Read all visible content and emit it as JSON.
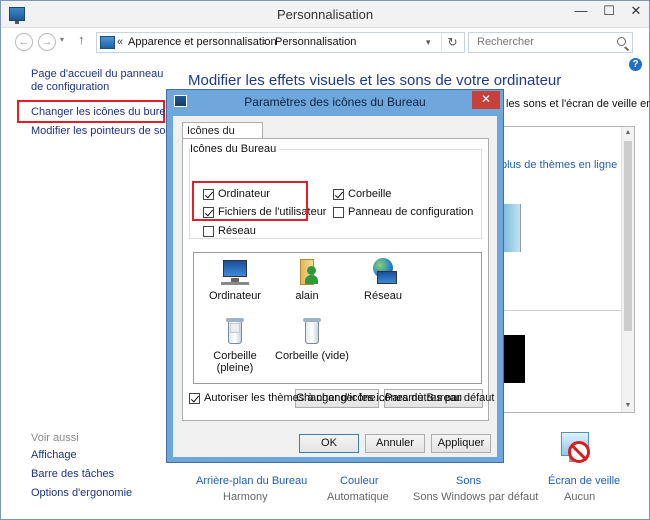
{
  "window": {
    "title": "Personnalisation",
    "minimize": "—",
    "maximize": "☐",
    "close": "✕"
  },
  "nav": {
    "back": "←",
    "forward": "→",
    "dropdown": "▾",
    "up": "↑"
  },
  "address": {
    "sep0": "«",
    "crumb1": "Apparence et personnalisation",
    "sep1": "›",
    "crumb2": "Personnalisation",
    "dropdown": "▾",
    "refresh": "↻"
  },
  "search": {
    "placeholder": "Rechercher"
  },
  "help": "?",
  "left_pane": {
    "home_link": "Page d'accueil du panneau de configuration",
    "change_icons": "Changer les icônes du bureau",
    "change_pointers": "Modifier les pointeurs de souris",
    "see_also": "Voir aussi",
    "see_also_links": [
      "Affichage",
      "Barre des tâches",
      "Options d'ergonomie"
    ]
  },
  "main": {
    "title": "Modifier les effets visuels et les sons de votre ordinateur",
    "subtitle": "les sons et l'écran de veille en",
    "more_themes": "plus de thèmes en ligne"
  },
  "bottom_items": [
    {
      "label": "Arrière-plan du Bureau",
      "value": "Harmony"
    },
    {
      "label": "Couleur",
      "value": "Automatique"
    },
    {
      "label": "Sons",
      "value": "Sons Windows par défaut"
    },
    {
      "label": "Écran de veille",
      "value": "Aucun"
    }
  ],
  "dialog": {
    "title": "Paramètres des icônes du Bureau",
    "close": "✕",
    "tab": "Icônes du Bureau",
    "group_title": "Icônes du Bureau",
    "checkboxes": [
      {
        "label": "Ordinateur",
        "checked": true
      },
      {
        "label": "Fichiers de l'utilisateur",
        "checked": true
      },
      {
        "label": "Réseau",
        "checked": false
      },
      {
        "label": "Corbeille",
        "checked": true
      },
      {
        "label": "Panneau de configuration",
        "checked": false
      }
    ],
    "icons": [
      {
        "name": "Ordinateur",
        "kind": "computer-icon"
      },
      {
        "name": "alain",
        "kind": "user-folder-icon"
      },
      {
        "name": "Réseau",
        "kind": "network-icon"
      },
      {
        "name": "Corbeille (pleine)",
        "kind": "recycle-bin-full-icon"
      },
      {
        "name": "Corbeille (vide)",
        "kind": "recycle-bin-empty-icon"
      }
    ],
    "change_icon_button": "Changer d'icône...",
    "default_button": "Paramètres par défaut",
    "allow_themes": {
      "label": "Autoriser les thèmes à changer les icônes du Bureau",
      "checked": true
    },
    "ok": "OK",
    "cancel": "Annuler",
    "apply": "Appliquer"
  },
  "colors": {
    "link": "#1e3287",
    "title": "#1e3a8a",
    "highlight": "#e0202a",
    "dialog_frame": "#6fa7dc"
  }
}
